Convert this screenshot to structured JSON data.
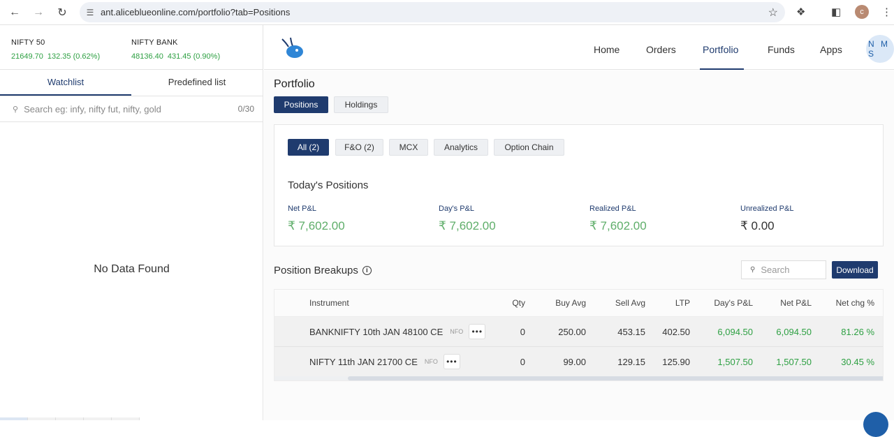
{
  "browser": {
    "url": "ant.aliceblueonline.com/portfolio?tab=Positions",
    "profile_initial": "c"
  },
  "indices": [
    {
      "name": "NIFTY 50",
      "value": "21649.70",
      "change": "132.35 (0.62%)"
    },
    {
      "name": "NIFTY BANK",
      "value": "48136.40",
      "change": "431.45 (0.90%)"
    }
  ],
  "watchlist": {
    "tabs": [
      "Watchlist",
      "Predefined list"
    ],
    "search_placeholder": "Search eg: infy, nifty fut, nifty, gold",
    "count": "0/30",
    "empty_text": "No Data Found"
  },
  "nav": {
    "links": [
      "Home",
      "Orders",
      "Portfolio",
      "Funds",
      "Apps"
    ],
    "active": "Portfolio",
    "avatar": "N M S"
  },
  "portfolio": {
    "title": "Portfolio",
    "tabs": [
      "Positions",
      "Holdings"
    ],
    "filters": [
      "All (2)",
      "F&O (2)",
      "MCX",
      "Analytics",
      "Option Chain"
    ],
    "todays_title": "Today's Positions",
    "stats": [
      {
        "label": "Net P&L",
        "value": "₹ 7,602.00"
      },
      {
        "label": "Day's P&L",
        "value": "₹ 7,602.00"
      },
      {
        "label": "Realized P&L",
        "value": "₹ 7,602.00"
      },
      {
        "label": "Unrealized P&L",
        "value": "₹ 0.00"
      }
    ],
    "breakup_title": "Position Breakups",
    "search_placeholder": "Search",
    "download_label": "Download",
    "columns": [
      "Instrument",
      "Qty",
      "Buy Avg",
      "Sell Avg",
      "LTP",
      "Day's P&L",
      "Net P&L",
      "Net chg %"
    ],
    "rows": [
      {
        "instrument": "BANKNIFTY 10th JAN 48100 CE",
        "exchange": "NFO",
        "qty": "0",
        "buy_avg": "250.00",
        "sell_avg": "453.15",
        "ltp": "402.50",
        "days_pnl": "6,094.50",
        "net_pnl": "6,094.50",
        "net_chg": "81.26 %"
      },
      {
        "instrument": "NIFTY 11th JAN 21700 CE",
        "exchange": "NFO",
        "qty": "0",
        "buy_avg": "99.00",
        "sell_avg": "129.15",
        "ltp": "125.90",
        "days_pnl": "1,507.50",
        "net_pnl": "1,507.50",
        "net_chg": "30.45 %"
      }
    ]
  },
  "colors": {
    "primary": "#1f3b6e",
    "positive": "#2ea043",
    "positive_light": "#5fae6a"
  }
}
